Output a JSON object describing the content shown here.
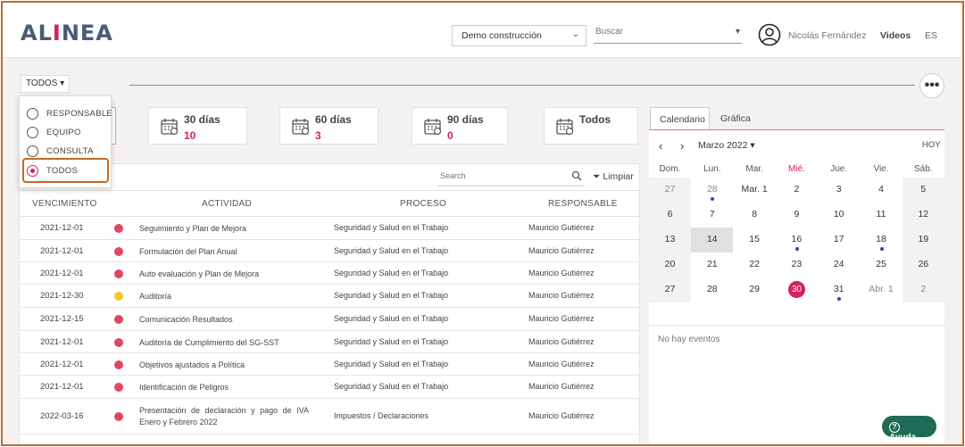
{
  "header": {
    "logo_text_pre": "AL",
    "logo_text_mid": "I",
    "logo_text_post": "NEA",
    "company_select": "Demo construcción",
    "search_placeholder": "Buscar",
    "user_name": "Nicolás Fernández",
    "videos_label": "Videos",
    "language": "ES"
  },
  "filter": {
    "button_label": "TODOS ▾",
    "more_label": "•••",
    "options": [
      {
        "label": "RESPONSABLE",
        "selected": false
      },
      {
        "label": "EQUIPO",
        "selected": false
      },
      {
        "label": "CONSULTA",
        "selected": false
      },
      {
        "label": "TODOS",
        "selected": true
      }
    ]
  },
  "cards": [
    {
      "title": "30 días",
      "count": "10"
    },
    {
      "title": "60 días",
      "count": "3"
    },
    {
      "title": "90 días",
      "count": "0"
    },
    {
      "title": "Todos",
      "count": ""
    }
  ],
  "table": {
    "search_placeholder": "Search",
    "clear_label": "Limpiar",
    "headers": {
      "due": "VENCIMIENTO",
      "activity": "ACTIVIDAD",
      "process": "PROCESO",
      "responsible": "RESPONSABLE"
    },
    "rows": [
      {
        "date": "2021-12-01",
        "status": "#e0475f",
        "activity": "Seguimiento y Plan de Mejora",
        "process": "Seguridad y Salud en el Trabajo",
        "responsible": "Mauricio Gutiérrez"
      },
      {
        "date": "2021-12-01",
        "status": "#e0475f",
        "activity": "Formulación del  Plan Anual",
        "process": "Seguridad y Salud en el Trabajo",
        "responsible": "Mauricio Gutiérrez"
      },
      {
        "date": "2021-12-01",
        "status": "#e0475f",
        "activity": "Auto evaluación y Plan de Mejora",
        "process": "Seguridad y Salud en el Trabajo",
        "responsible": "Mauricio Gutiérrez"
      },
      {
        "date": "2021-12-30",
        "status": "#f4c430",
        "activity": "Auditoría",
        "process": "Seguridad y Salud en el Trabajo",
        "responsible": "Mauricio Gutiérrez"
      },
      {
        "date": "2021-12-15",
        "status": "#e0475f",
        "activity": "Comunicación Resultados",
        "process": "Seguridad y Salud en el Trabajo",
        "responsible": "Mauricio Gutiérrez"
      },
      {
        "date": "2021-12-01",
        "status": "#e0475f",
        "activity": "Auditoría de Cumplimiento del SG-SST",
        "process": "Seguridad y Salud en el Trabajo",
        "responsible": "Mauricio Gutiérrez"
      },
      {
        "date": "2021-12-01",
        "status": "#e0475f",
        "activity": "Objetivos ajustados a Política",
        "process": "Seguridad y Salud en el Trabajo",
        "responsible": "Mauricio Gutiérrez"
      },
      {
        "date": "2021-12-01",
        "status": "#e0475f",
        "activity": "Identificación de Peligros",
        "process": "Seguridad y Salud en el Trabajo",
        "responsible": "Mauricio Gutiérrez"
      },
      {
        "date": "2022-03-16",
        "status": "#e0475f",
        "activity": "Presentación de declaración y pago de IVA Enero y Febrero 2022",
        "process": "Impuestos / Declaraciones",
        "responsible": "Mauricio Gutiérrez"
      }
    ]
  },
  "calendar": {
    "tabs": [
      "Calendario",
      "Gráfica"
    ],
    "prev": "‹",
    "next": "›",
    "month": "Marzo 2022 ▾",
    "today_label": "HOY",
    "weekdays": [
      "Dom.",
      "Lun.",
      "Mar.",
      "Mié.",
      "Jue.",
      "Vie.",
      "Sáb."
    ],
    "weeks": [
      [
        {
          "d": "27",
          "m": true
        },
        {
          "d": "28",
          "m": true,
          "e": true
        },
        {
          "d": "Mar. 1"
        },
        {
          "d": "2"
        },
        {
          "d": "3"
        },
        {
          "d": "4"
        },
        {
          "d": "5"
        }
      ],
      [
        {
          "d": "6"
        },
        {
          "d": "7"
        },
        {
          "d": "8"
        },
        {
          "d": "9"
        },
        {
          "d": "10"
        },
        {
          "d": "11"
        },
        {
          "d": "12"
        }
      ],
      [
        {
          "d": "13"
        },
        {
          "d": "14",
          "s": true
        },
        {
          "d": "15"
        },
        {
          "d": "16",
          "e": true
        },
        {
          "d": "17"
        },
        {
          "d": "18",
          "e": true
        },
        {
          "d": "19"
        }
      ],
      [
        {
          "d": "20"
        },
        {
          "d": "21"
        },
        {
          "d": "22"
        },
        {
          "d": "23"
        },
        {
          "d": "24"
        },
        {
          "d": "25"
        },
        {
          "d": "26"
        }
      ],
      [
        {
          "d": "27"
        },
        {
          "d": "28"
        },
        {
          "d": "29"
        },
        {
          "d": "30",
          "t": true
        },
        {
          "d": "31",
          "e": true
        },
        {
          "d": "Abr. 1",
          "m": true
        },
        {
          "d": "2",
          "m": true
        }
      ]
    ],
    "no_events": "No hay eventos"
  },
  "help": {
    "label": "Ayuda"
  },
  "colors": {
    "accent": "#d3225d",
    "help": "#1f6b55",
    "highlight": "#c56a23"
  }
}
